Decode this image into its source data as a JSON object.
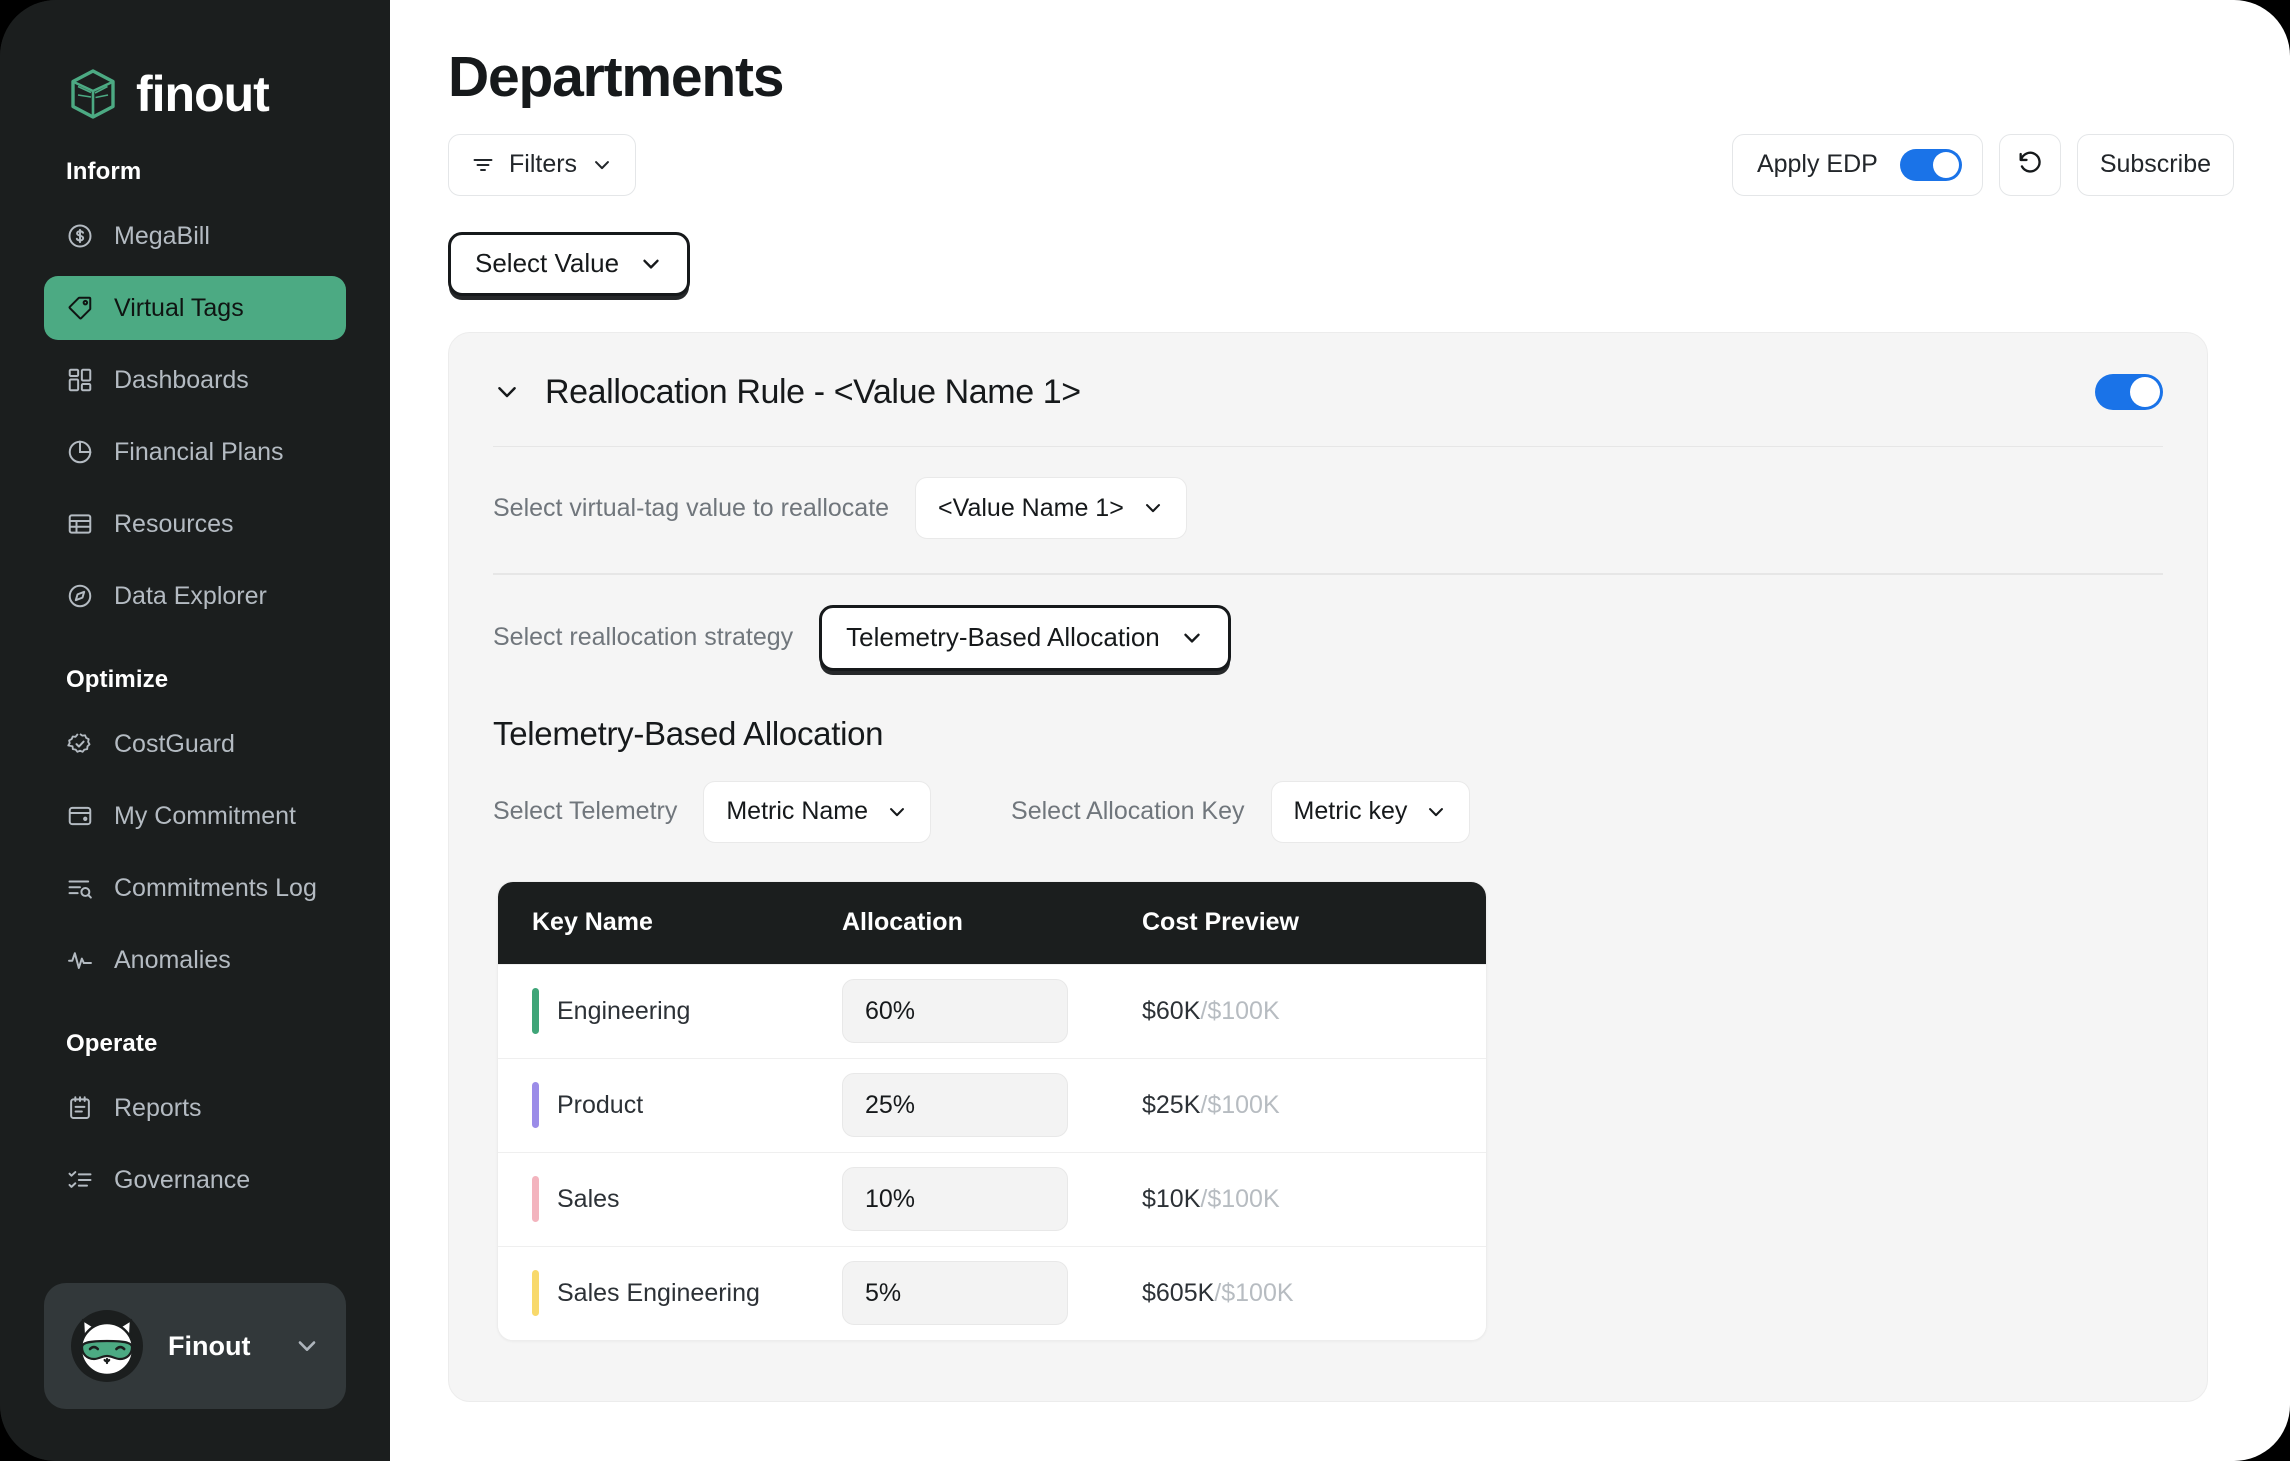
{
  "brand": {
    "name": "finout",
    "logo_icon": "finout-cube-icon"
  },
  "sidebar": {
    "sections": [
      {
        "label": "Inform",
        "items": [
          {
            "label": "MegaBill",
            "icon": "dollar-circle-icon",
            "active": false
          },
          {
            "label": "Virtual Tags",
            "icon": "tag-icon",
            "active": true
          },
          {
            "label": "Dashboards",
            "icon": "grid-icon",
            "active": false
          },
          {
            "label": "Financial Plans",
            "icon": "pie-chart-icon",
            "active": false
          },
          {
            "label": "Resources",
            "icon": "table-icon",
            "active": false
          },
          {
            "label": "Data Explorer",
            "icon": "compass-icon",
            "active": false
          }
        ]
      },
      {
        "label": "Optimize",
        "items": [
          {
            "label": "CostGuard",
            "icon": "badge-check-icon",
            "active": false
          },
          {
            "label": "My Commitment",
            "icon": "wallet-icon",
            "active": false
          },
          {
            "label": "Commitments Log",
            "icon": "list-search-icon",
            "active": false
          },
          {
            "label": "Anomalies",
            "icon": "activity-pulse-icon",
            "active": false
          }
        ]
      },
      {
        "label": "Operate",
        "items": [
          {
            "label": "Reports",
            "icon": "notepad-icon",
            "active": false
          },
          {
            "label": "Governance",
            "icon": "checklist-icon",
            "active": false
          }
        ]
      }
    ],
    "account": {
      "name": "Finout",
      "avatar_icon": "cat-mascot-avatar",
      "chevron_icon": "chevron-down-icon"
    }
  },
  "header": {
    "title": "Departments",
    "filters_label": "Filters",
    "filters_icon": "filter-icon",
    "apply_edp_label": "Apply EDP",
    "apply_edp_on": true,
    "refresh_icon": "refresh-counterclockwise-icon",
    "subscribe_label": "Subscribe",
    "select_value_label": "Select Value"
  },
  "rule": {
    "title": "Reallocation Rule - <Value Name 1>",
    "enabled": true,
    "virtual_tag_label": "Select virtual-tag value to reallocate",
    "virtual_tag_value": "<Value Name 1>",
    "strategy_label": "Select reallocation strategy",
    "strategy_value": "Telemetry-Based Allocation",
    "section_title": "Telemetry-Based Allocation",
    "telemetry_label": "Select Telemetry",
    "telemetry_value": "Metric Name",
    "allocation_key_label": "Select Allocation Key",
    "allocation_key_value": "Metric key"
  },
  "table": {
    "columns": [
      "Key Name",
      "Allocation",
      "Cost Preview"
    ],
    "rows": [
      {
        "key": "Engineering",
        "color": "#3fa578",
        "allocation": "60%",
        "cost": "$60K",
        "cost_total": "/$100K"
      },
      {
        "key": "Product",
        "color": "#9b8ce8",
        "allocation": "25%",
        "cost": "$25K",
        "cost_total": "/$100K"
      },
      {
        "key": "Sales",
        "color": "#f3b4be",
        "allocation": "10%",
        "cost": "$10K",
        "cost_total": "/$100K"
      },
      {
        "key": "Sales Engineering",
        "color": "#f8d96b",
        "allocation": "5%",
        "cost": "$605K",
        "cost_total": "/$100K"
      }
    ]
  },
  "colors": {
    "accent_green": "#4caa83",
    "toggle_blue": "#1a73e8",
    "sidebar_bg": "#1b1e1e",
    "card_bg": "#f5f5f5",
    "table_head_bg": "#1b1e1e"
  }
}
